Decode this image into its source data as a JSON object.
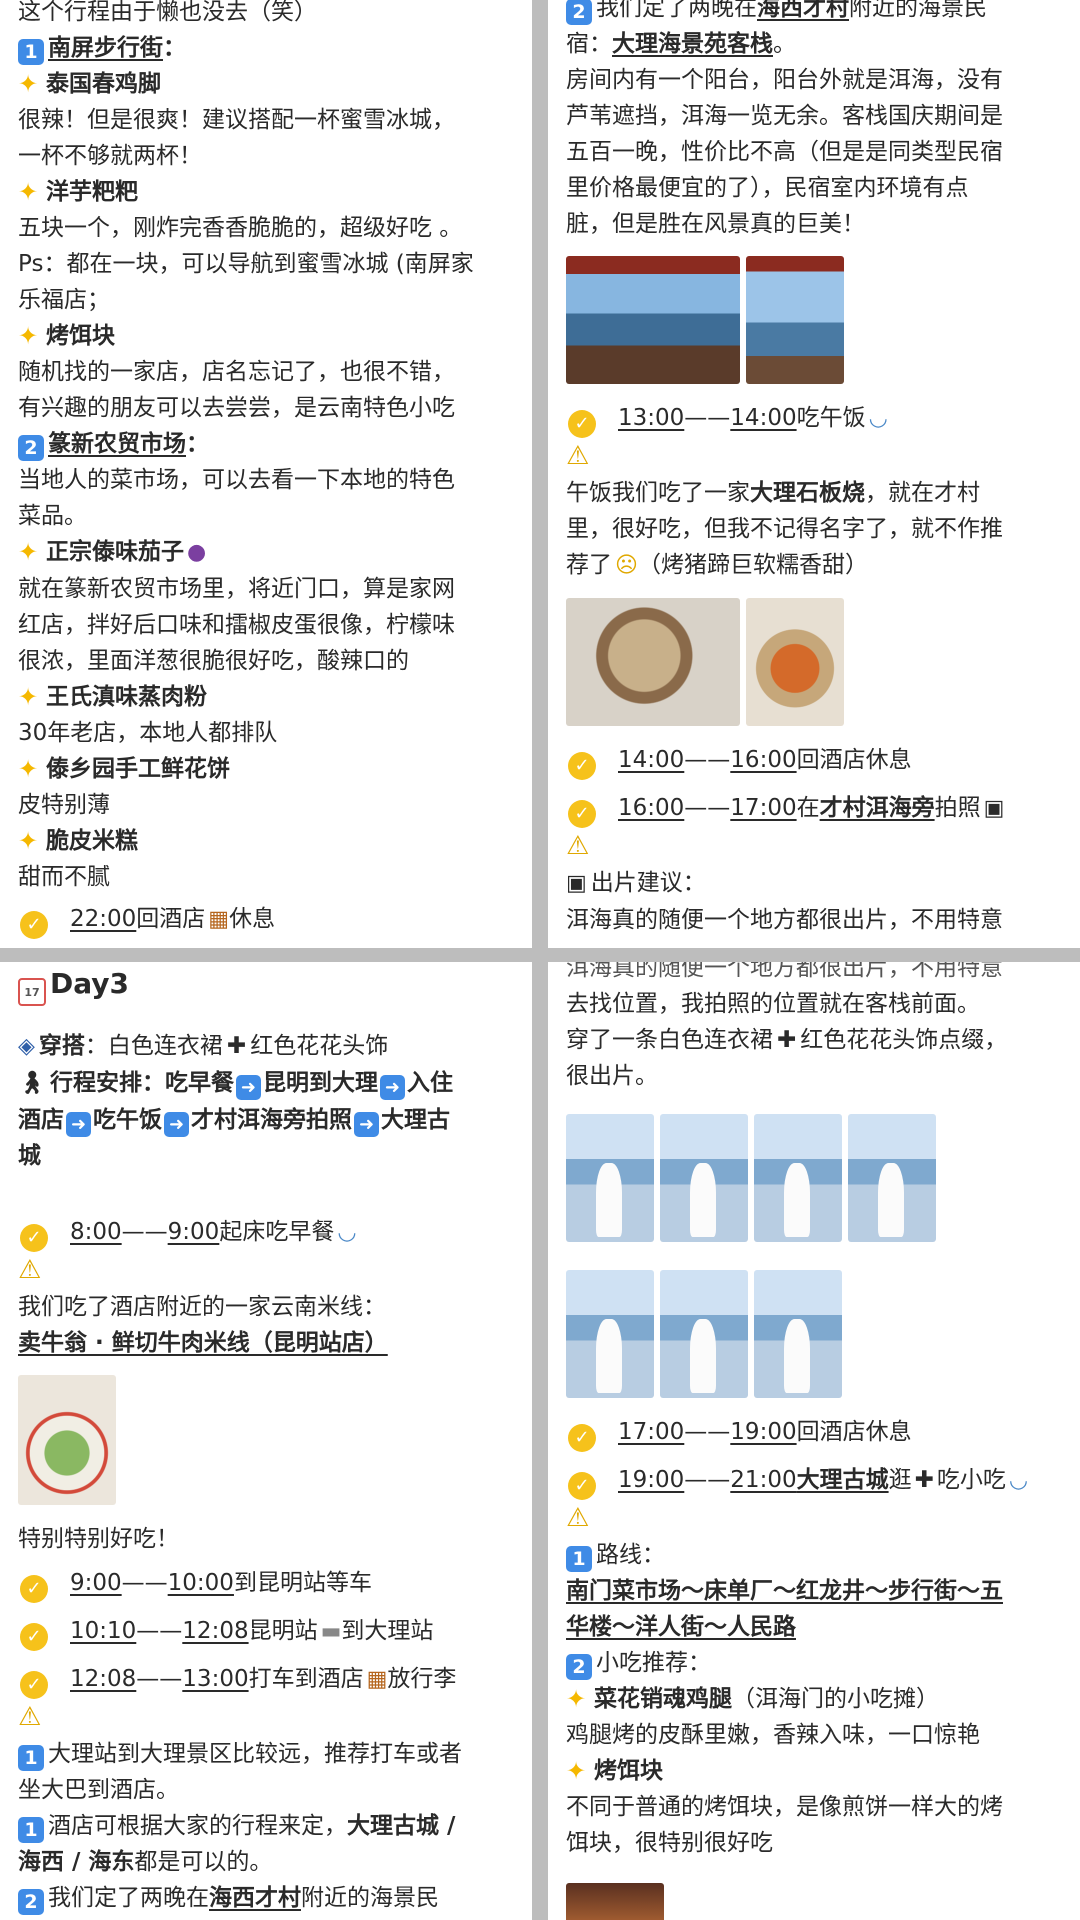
{
  "tl": {
    "intro": "这个行程由于懒也没去（笑）",
    "s1_num": "1",
    "s1_title": "南屏步行街",
    "colon": "：",
    "f1_name": "泰国春鸡脚",
    "f1_l1": "很辣！但是很爽！建议搭配一杯蜜雪冰城，",
    "f1_l2": "一杯不够就两杯！",
    "f2_name": "洋芋粑粑",
    "f2_l1": "五块一个，刚炸完香香脆脆的，超级好吃 。",
    "f2_l2": "Ps：都在一块，可以导航到蜜雪冰城 (南屏家",
    "f2_l3": "乐福店；",
    "f3_name": "烤饵块",
    "f3_l1": "随机找的一家店，店名忘记了，也很不错，",
    "f3_l2": "有兴趣的朋友可以去尝尝，是云南特色小吃",
    "s2_num": "2",
    "s2_title": "篆新农贸市场",
    "s2_l1": "当地人的菜市场，可以去看一下本地的特色",
    "s2_l2": "菜品。",
    "f4_name": "正宗傣味茄子",
    "f4_l1": "就在篆新农贸市场里，将近门口，算是家网",
    "f4_l2": "红店，拌好后口味和擂椒皮蛋很像，柠檬味",
    "f4_l3": "很浓，里面洋葱很脆很好吃，酸辣口的",
    "f5_name": "王氏滇味蒸肉粉",
    "f5_l1": "30年老店，本地人都排队",
    "f6_name": "傣乡园手工鲜花饼",
    "f6_l1": "皮特别薄",
    "f7_name": "脆皮米糕",
    "f7_l1": "甜而不腻",
    "t1_time": "22:00",
    "t1_text": "回酒店",
    "t1_tail": "休息"
  },
  "tr": {
    "a_num": "2",
    "a_l1_pre": "我们定了两晚在",
    "a_l1_link": "海西才村",
    "a_l1_post": "附近的海景民",
    "a_l2_pre": "宿：",
    "a_l2_link": "大理海景苑客栈",
    "a_l2_post": "。",
    "b_l1": "房间内有一个阳台，阳台外就是洱海，没有",
    "b_l2": "芦苇遮挡，洱海一览无余。客栈国庆期间是",
    "b_l3": "五百一晚，性价比不高（但是是同类型民宿",
    "b_l4": "里价格最便宜的了），民宿室内环境有点",
    "b_l5": "脏，但是胜在风景真的巨美！",
    "t1_start": "13:00",
    "t1_dash": "——",
    "t1_end": "14:00",
    "t1_text": "吃午饭",
    "lunch_l1_pre": "午饭我们吃了一家",
    "lunch_l1_bold": "大理石板烧",
    "lunch_l1_post": "，就在才村",
    "lunch_l2": "里，很好吃，但我不记得名字了，就不作推",
    "lunch_l3_pre": "荐了",
    "lunch_l3_post": "（烤猪蹄巨软糯香甜）",
    "t2_start": "14:00",
    "t2_end": "16:00",
    "t2_text": "回酒店休息",
    "t3_start": "16:00",
    "t3_end": "17:00",
    "t3_pre": "在",
    "t3_link": "才村洱海旁",
    "t3_post": "拍照",
    "tip_title": "出片建议：",
    "tip_l1": "洱海真的随便一个地方都很出片，不用特意"
  },
  "bl": {
    "day": "Day3",
    "cal_num": "17",
    "wear_label": "穿搭",
    "wear_text": "：白色连衣裙",
    "wear_tail": "红色花花头饰",
    "plan_label": "行程安排：",
    "plan_s1": "吃早餐",
    "plan_s2": "昆明到大理",
    "plan_s3": "入住",
    "plan_s4": "酒店",
    "plan_s5": "吃午饭",
    "plan_s6": "才村洱海旁拍照",
    "plan_s7": "大理古",
    "plan_s8": "城",
    "t1_start": "8:00",
    "t1_dash": "——",
    "t1_end": "9:00",
    "t1_text": "起床吃早餐",
    "bf_l1": "我们吃了酒店附近的一家云南米线：",
    "bf_l2": "卖牛翁 · 鲜切牛肉米线（昆明站店）",
    "bf_review": "特别特别好吃！",
    "t2_start": "9:00",
    "t2_end": "10:00",
    "t2_text": "到昆明站等车",
    "t3_start": "10:10",
    "t3_end": "12:08",
    "t3_pre": "昆明站",
    "t3_post": "到大理站",
    "t4_start": "12:08",
    "t4_end": "13:00",
    "t4_pre": "打车到酒店",
    "t4_post": "放行李",
    "n1_num": "1",
    "n1_l1": "大理站到大理景区比较远，推荐打车或者",
    "n1_l2": "坐大巴到酒店。",
    "n2_num": "1",
    "n2_l1_pre": "酒店可根据大家的行程来定，",
    "n2_l1_bold": "大理古城 /",
    "n2_l2_bold": "海西 / 海东",
    "n2_l2_post": "都是可以的。",
    "n3_num": "2",
    "n3_pre": "我们定了两晚在",
    "n3_link": "海西才村",
    "n3_post": "附近的海景民"
  },
  "br": {
    "top_l1": "洱海真的随便一个地方都很出片，不用特意",
    "top_l2": "去找位置，我拍照的位置就在客栈前面。",
    "top_l3_pre": "穿了一条白色连衣裙",
    "top_l3_post": "红色花花头饰点缀，",
    "top_l4": "很出片。",
    "t1_start": "17:00",
    "t1_dash": "——",
    "t1_end": "19:00",
    "t1_text": "回酒店休息",
    "t2_start": "19:00",
    "t2_end": "21:00",
    "t2_link": "大理古城",
    "t2_mid": "逛",
    "t2_post": "吃小吃",
    "r_num": "1",
    "r_label": "路线：",
    "route_l1": "南门菜市场～床单厂～红龙井～步行街～五",
    "route_l2": "华楼～洋人街～人民路",
    "s_num": "2",
    "s_label": "小吃推荐：",
    "f1_name": "菜花销魂鸡腿",
    "f1_note": "（洱海门的小吃摊）",
    "f1_desc": "鸡腿烤的皮酥里嫩，香辣入味，一口惊艳",
    "f2_name": "烤饵块",
    "f2_l1": "不同于普通的烤饵块，是像煎饼一样大的烤",
    "f2_l2": "饵块，很特别很好吃"
  },
  "icons": {
    "star": "star-icon",
    "check": "check-circle-icon",
    "warning": "warning-icon",
    "camera": "camera-icon",
    "hotel": "hotel-icon",
    "bowl": "bowl-icon",
    "train": "train-icon",
    "eggplant": "eggplant-icon",
    "crying": "crying-face-icon",
    "plus": "plus-icon",
    "arrow": "right-arrow-icon",
    "calendar": "calendar-icon",
    "shirt": "shirt-icon",
    "walking": "walking-person-icon"
  },
  "colors": {
    "accent_blue": "#3f8be6",
    "check_yellow": "#f6c21b",
    "star_gold": "#f5b800",
    "divider": "#bdbdbd"
  }
}
